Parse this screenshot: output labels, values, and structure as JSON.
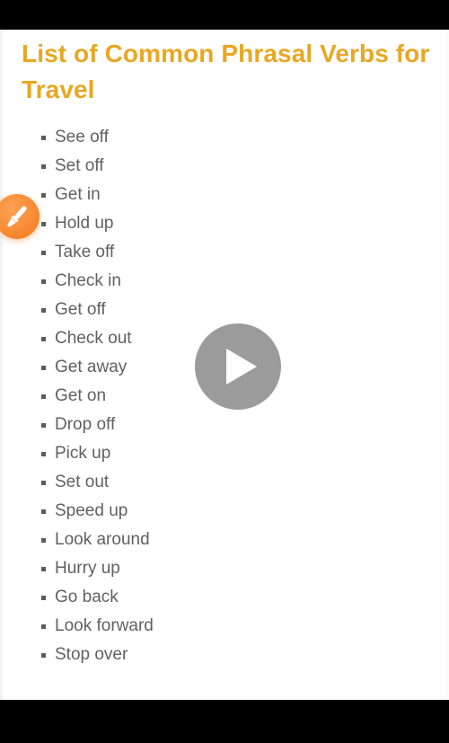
{
  "article": {
    "title": "List of Common Phrasal Verbs for Travel",
    "title_color": "#e8a722",
    "body_text_color": "#616161",
    "background_color": "#ffffff"
  },
  "phrasal_verbs": [
    "See off",
    "Set off",
    "Get in",
    "Hold up",
    "Take off",
    "Check in",
    "Get off",
    "Check out",
    "Get away",
    "Get on",
    "Drop off",
    "Pick up",
    "Set out",
    "Speed up",
    "Look around",
    "Hurry up",
    "Go back",
    "Look forward",
    "Stop over"
  ],
  "controls": {
    "edit_fab": {
      "icon": "paintbrush-icon",
      "color": "#f4822a"
    },
    "video_play": {
      "icon": "play-icon",
      "color": "#9b9b9b"
    }
  },
  "letterbox": {
    "color": "#000000"
  }
}
